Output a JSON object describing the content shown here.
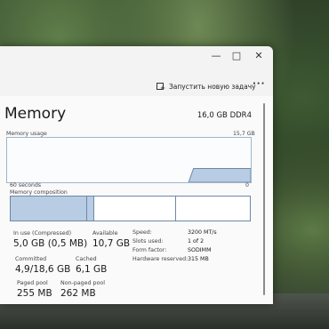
{
  "window": {
    "controls": {
      "minimize": "—",
      "maximize": "□",
      "close": "✕"
    }
  },
  "commandbar": {
    "run_task_label": "Запустить новую задачу",
    "run_task_icon": "run-task-icon",
    "more_label": "···"
  },
  "memory": {
    "title": "Memory",
    "spec": "16,0 GB DDR4",
    "usage_label": "Memory usage",
    "usage_max": "15,7 GB",
    "time_left": "60 seconds",
    "time_right": "0",
    "composition_label": "Memory composition",
    "usage_level_fraction": 0.31,
    "composition": {
      "in_use_fraction": 0.32,
      "modified_fraction": 0.03,
      "standby_fraction": 0.34,
      "free_fraction": 0.31
    }
  },
  "stats": {
    "in_use_label": "In use (Compressed)",
    "in_use_value": "5,0 GB (0,5 MB)",
    "available_label": "Available",
    "available_value": "10,7 GB",
    "committed_label": "Committed",
    "committed_value": "4,9/18,6 GB",
    "cached_label": "Cached",
    "cached_value": "6,1 GB",
    "paged_pool_label": "Paged pool",
    "paged_pool_value": "255 MB",
    "nonpaged_pool_label": "Non-paged pool",
    "nonpaged_pool_value": "262 MB"
  },
  "details": {
    "speed_label": "Speed:",
    "speed_value": "3200 MT/s",
    "slots_label": "Slots used:",
    "slots_value": "1 of 2",
    "form_label": "Form factor:",
    "form_value": "SODIMM",
    "reserved_label": "Hardware reserved:",
    "reserved_value": "315 MB"
  },
  "colors": {
    "graph_fill": "#b8cce4",
    "graph_line": "#6c88a6",
    "window_bg": "#f3f3f3"
  }
}
